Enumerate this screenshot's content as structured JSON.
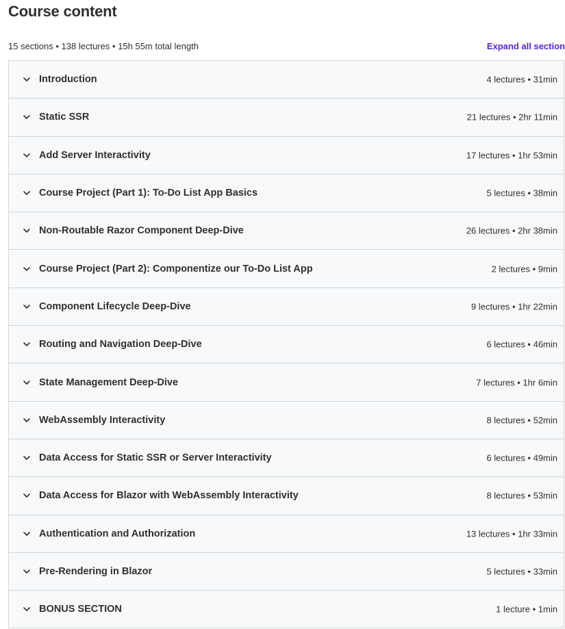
{
  "header": {
    "title": "Course content",
    "summary": "15 sections • 138 lectures • 15h 55m total length",
    "expand_all_label": "Expand all section"
  },
  "colors": {
    "accent": "#5624d0",
    "section_bg": "#f7f9fa",
    "border": "#d1d7dc",
    "text": "#2d2f31"
  },
  "icons": {
    "section_toggle": "chevron-down-icon"
  },
  "sections": [
    {
      "title": "Introduction",
      "meta": "4 lectures • 31min"
    },
    {
      "title": "Static SSR",
      "meta": "21 lectures • 2hr 11min"
    },
    {
      "title": "Add Server Interactivity",
      "meta": "17 lectures • 1hr 53min"
    },
    {
      "title": "Course Project (Part 1): To-Do List App Basics",
      "meta": "5 lectures • 38min"
    },
    {
      "title": "Non-Routable Razor Component Deep-Dive",
      "meta": "26 lectures • 2hr 38min"
    },
    {
      "title": "Course Project (Part 2): Componentize our To-Do List App",
      "meta": "2 lectures • 9min"
    },
    {
      "title": "Component Lifecycle Deep-Dive",
      "meta": "9 lectures • 1hr 22min"
    },
    {
      "title": "Routing and Navigation Deep-Dive",
      "meta": "6 lectures • 46min"
    },
    {
      "title": "State Management Deep-Dive",
      "meta": "7 lectures • 1hr 6min"
    },
    {
      "title": "WebAssembly Interactivity",
      "meta": "8 lectures • 52min"
    },
    {
      "title": "Data Access for Static SSR or Server Interactivity",
      "meta": "6 lectures • 49min"
    },
    {
      "title": "Data Access for Blazor with WebAssembly Interactivity",
      "meta": "8 lectures • 53min"
    },
    {
      "title": "Authentication and Authorization",
      "meta": "13 lectures • 1hr 33min"
    },
    {
      "title": "Pre-Rendering in Blazor",
      "meta": "5 lectures • 33min"
    },
    {
      "title": "BONUS SECTION",
      "meta": "1 lecture • 1min"
    }
  ]
}
